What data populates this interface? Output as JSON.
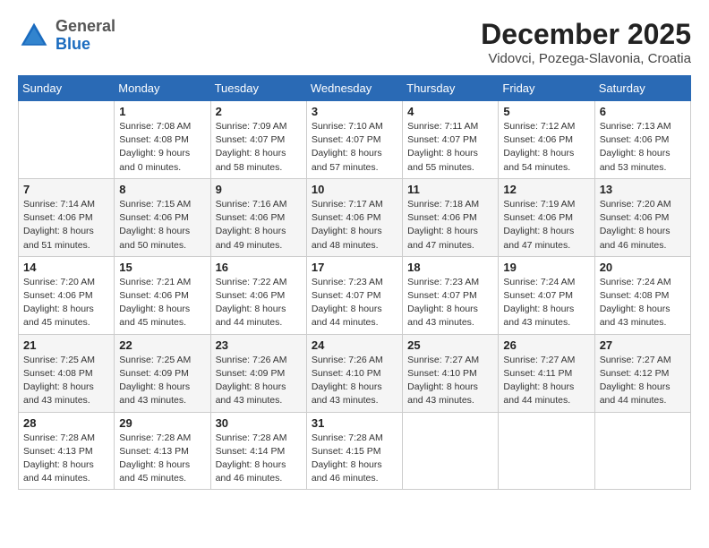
{
  "header": {
    "logo_general": "General",
    "logo_blue": "Blue",
    "month_title": "December 2025",
    "location": "Vidovci, Pozega-Slavonia, Croatia"
  },
  "weekdays": [
    "Sunday",
    "Monday",
    "Tuesday",
    "Wednesday",
    "Thursday",
    "Friday",
    "Saturday"
  ],
  "weeks": [
    [
      {
        "day": "",
        "info": ""
      },
      {
        "day": "1",
        "info": "Sunrise: 7:08 AM\nSunset: 4:08 PM\nDaylight: 9 hours\nand 0 minutes."
      },
      {
        "day": "2",
        "info": "Sunrise: 7:09 AM\nSunset: 4:07 PM\nDaylight: 8 hours\nand 58 minutes."
      },
      {
        "day": "3",
        "info": "Sunrise: 7:10 AM\nSunset: 4:07 PM\nDaylight: 8 hours\nand 57 minutes."
      },
      {
        "day": "4",
        "info": "Sunrise: 7:11 AM\nSunset: 4:07 PM\nDaylight: 8 hours\nand 55 minutes."
      },
      {
        "day": "5",
        "info": "Sunrise: 7:12 AM\nSunset: 4:06 PM\nDaylight: 8 hours\nand 54 minutes."
      },
      {
        "day": "6",
        "info": "Sunrise: 7:13 AM\nSunset: 4:06 PM\nDaylight: 8 hours\nand 53 minutes."
      }
    ],
    [
      {
        "day": "7",
        "info": "Sunrise: 7:14 AM\nSunset: 4:06 PM\nDaylight: 8 hours\nand 51 minutes."
      },
      {
        "day": "8",
        "info": "Sunrise: 7:15 AM\nSunset: 4:06 PM\nDaylight: 8 hours\nand 50 minutes."
      },
      {
        "day": "9",
        "info": "Sunrise: 7:16 AM\nSunset: 4:06 PM\nDaylight: 8 hours\nand 49 minutes."
      },
      {
        "day": "10",
        "info": "Sunrise: 7:17 AM\nSunset: 4:06 PM\nDaylight: 8 hours\nand 48 minutes."
      },
      {
        "day": "11",
        "info": "Sunrise: 7:18 AM\nSunset: 4:06 PM\nDaylight: 8 hours\nand 47 minutes."
      },
      {
        "day": "12",
        "info": "Sunrise: 7:19 AM\nSunset: 4:06 PM\nDaylight: 8 hours\nand 47 minutes."
      },
      {
        "day": "13",
        "info": "Sunrise: 7:20 AM\nSunset: 4:06 PM\nDaylight: 8 hours\nand 46 minutes."
      }
    ],
    [
      {
        "day": "14",
        "info": "Sunrise: 7:20 AM\nSunset: 4:06 PM\nDaylight: 8 hours\nand 45 minutes."
      },
      {
        "day": "15",
        "info": "Sunrise: 7:21 AM\nSunset: 4:06 PM\nDaylight: 8 hours\nand 45 minutes."
      },
      {
        "day": "16",
        "info": "Sunrise: 7:22 AM\nSunset: 4:06 PM\nDaylight: 8 hours\nand 44 minutes."
      },
      {
        "day": "17",
        "info": "Sunrise: 7:23 AM\nSunset: 4:07 PM\nDaylight: 8 hours\nand 44 minutes."
      },
      {
        "day": "18",
        "info": "Sunrise: 7:23 AM\nSunset: 4:07 PM\nDaylight: 8 hours\nand 43 minutes."
      },
      {
        "day": "19",
        "info": "Sunrise: 7:24 AM\nSunset: 4:07 PM\nDaylight: 8 hours\nand 43 minutes."
      },
      {
        "day": "20",
        "info": "Sunrise: 7:24 AM\nSunset: 4:08 PM\nDaylight: 8 hours\nand 43 minutes."
      }
    ],
    [
      {
        "day": "21",
        "info": "Sunrise: 7:25 AM\nSunset: 4:08 PM\nDaylight: 8 hours\nand 43 minutes."
      },
      {
        "day": "22",
        "info": "Sunrise: 7:25 AM\nSunset: 4:09 PM\nDaylight: 8 hours\nand 43 minutes."
      },
      {
        "day": "23",
        "info": "Sunrise: 7:26 AM\nSunset: 4:09 PM\nDaylight: 8 hours\nand 43 minutes."
      },
      {
        "day": "24",
        "info": "Sunrise: 7:26 AM\nSunset: 4:10 PM\nDaylight: 8 hours\nand 43 minutes."
      },
      {
        "day": "25",
        "info": "Sunrise: 7:27 AM\nSunset: 4:10 PM\nDaylight: 8 hours\nand 43 minutes."
      },
      {
        "day": "26",
        "info": "Sunrise: 7:27 AM\nSunset: 4:11 PM\nDaylight: 8 hours\nand 44 minutes."
      },
      {
        "day": "27",
        "info": "Sunrise: 7:27 AM\nSunset: 4:12 PM\nDaylight: 8 hours\nand 44 minutes."
      }
    ],
    [
      {
        "day": "28",
        "info": "Sunrise: 7:28 AM\nSunset: 4:13 PM\nDaylight: 8 hours\nand 44 minutes."
      },
      {
        "day": "29",
        "info": "Sunrise: 7:28 AM\nSunset: 4:13 PM\nDaylight: 8 hours\nand 45 minutes."
      },
      {
        "day": "30",
        "info": "Sunrise: 7:28 AM\nSunset: 4:14 PM\nDaylight: 8 hours\nand 46 minutes."
      },
      {
        "day": "31",
        "info": "Sunrise: 7:28 AM\nSunset: 4:15 PM\nDaylight: 8 hours\nand 46 minutes."
      },
      {
        "day": "",
        "info": ""
      },
      {
        "day": "",
        "info": ""
      },
      {
        "day": "",
        "info": ""
      }
    ]
  ]
}
